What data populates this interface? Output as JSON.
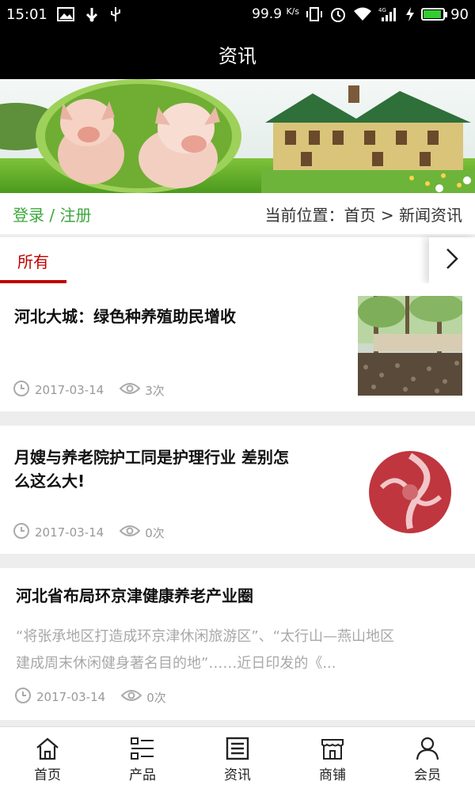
{
  "status_bar": {
    "time": "15:01",
    "net_speed": "99.9",
    "net_unit": "K/s",
    "battery_level": 90,
    "battery_text": "90",
    "icons": [
      "image-icon",
      "usb-icon",
      "debug-icon",
      "vibrate-icon",
      "alarm-icon",
      "wifi-icon",
      "signal-4g-icon",
      "charging-icon",
      "battery-icon"
    ]
  },
  "header": {
    "title": "资讯"
  },
  "location": {
    "login": "登录",
    "separator": "/",
    "register": "注册",
    "current_label": "当前位置：",
    "home": "首页",
    "arrow": ">",
    "current": "新闻资讯"
  },
  "tabs": {
    "active": "所有",
    "more_icon": "chevron-right-icon"
  },
  "news": [
    {
      "title": "河北大城：绿色种养殖助民增收",
      "date": "2017-03-14",
      "views": "3次"
    },
    {
      "title_line1": "月嫂与养老院护工同是护理行业 差别怎",
      "title_line2": "么这么大!",
      "date": "2017-03-14",
      "views": "0次"
    },
    {
      "title": "河北省布局环京津健康养老产业圈",
      "summary_line1": "“将张承地区打造成环京津休闲旅游区”、“太行山—燕山地区",
      "summary_line2": "建成周末休闲健身著名目的地”……近日印发的《...",
      "date": "2017-03-14",
      "views": "0次"
    }
  ],
  "bottom_nav": [
    {
      "label": "首页",
      "icon": "home-icon"
    },
    {
      "label": "产品",
      "icon": "product-list-icon"
    },
    {
      "label": "资讯",
      "icon": "news-icon"
    },
    {
      "label": "商铺",
      "icon": "shop-icon"
    },
    {
      "label": "会员",
      "icon": "user-icon"
    }
  ],
  "colors": {
    "accent_red": "#c00000",
    "login_green": "#3ca73c",
    "header_bg": "#000000"
  }
}
